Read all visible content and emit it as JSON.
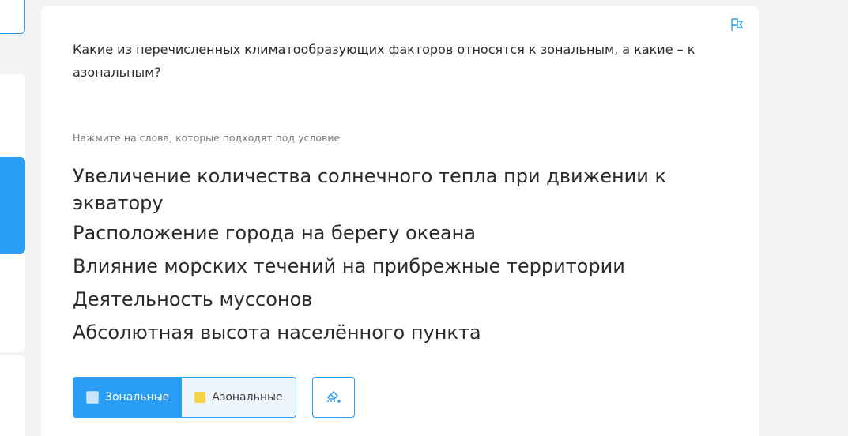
{
  "question": {
    "text": "Какие из перечисленных климатообразующих факторов относятся к зональным, а какие – к азональным?",
    "hint": "Нажмите на слова, которые подходят под условие"
  },
  "options": [
    "Увеличение количества солнечного тепла при движении к экватору",
    "Расположение города на берегу океана",
    "Влияние морских течений на прибрежные территории",
    "Деятельность муссонов",
    "Абсолютная высота населённого пункта"
  ],
  "categories": {
    "zonal_label": "Зональные",
    "azonal_label": "Азональные",
    "active": "zonal"
  },
  "icons": {
    "flag": "flag-icon",
    "eraser": "eraser-icon"
  },
  "colors": {
    "accent": "#2a9df4",
    "zonal_swatch": "#cbe6fb",
    "azonal_swatch": "#f6d24a"
  }
}
